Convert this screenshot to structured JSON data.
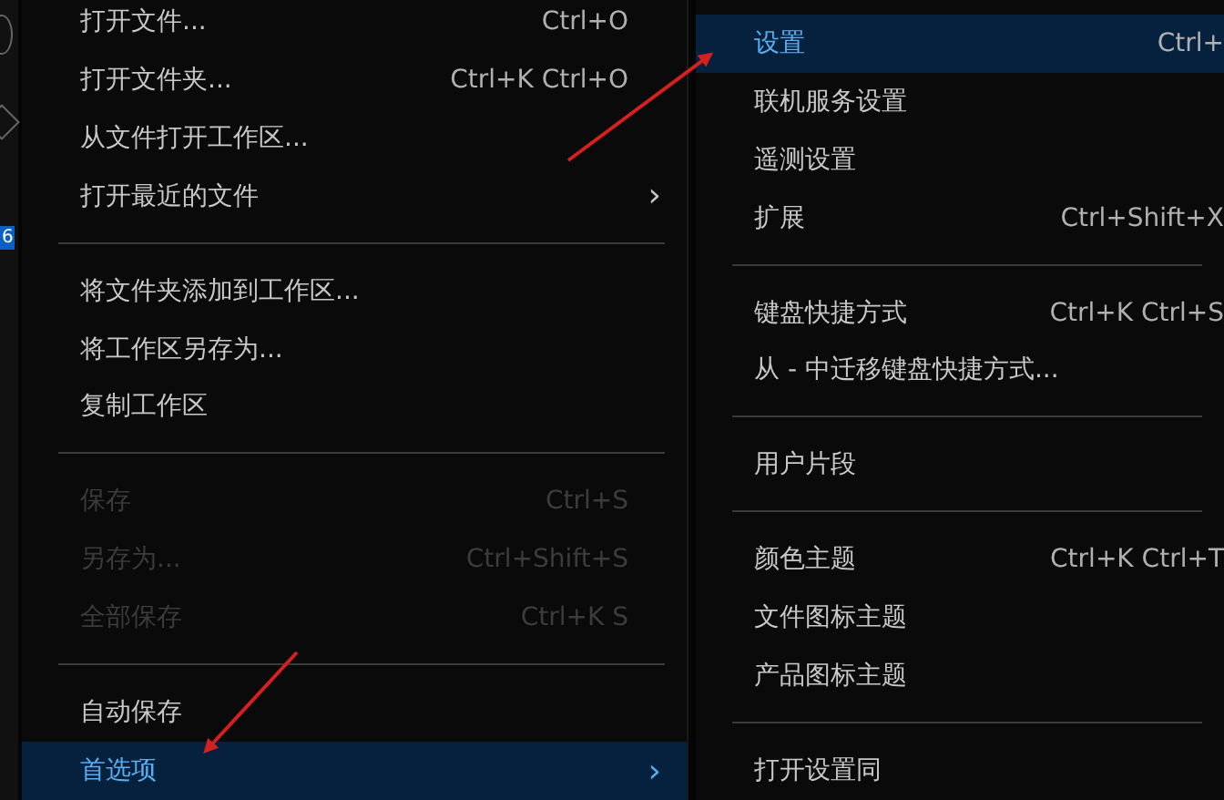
{
  "activity_bar": {
    "badge": "6"
  },
  "file_menu": [
    {
      "kind": "item",
      "label": "打开文件...",
      "shortcut": "Ctrl+O",
      "disabled": false,
      "selected": false
    },
    {
      "kind": "item",
      "label": "打开文件夹...",
      "shortcut": "Ctrl+K Ctrl+O",
      "disabled": false,
      "selected": false
    },
    {
      "kind": "item",
      "label": "从文件打开工作区...",
      "disabled": false,
      "selected": false
    },
    {
      "kind": "item",
      "label": "打开最近的文件",
      "submenu": "›",
      "disabled": false,
      "selected": false
    },
    {
      "kind": "separator"
    },
    {
      "kind": "item",
      "label": "将文件夹添加到工作区...",
      "disabled": false,
      "selected": false
    },
    {
      "kind": "item",
      "label": "将工作区另存为...",
      "disabled": false,
      "selected": false
    },
    {
      "kind": "item",
      "label": "复制工作区",
      "disabled": false,
      "selected": false
    },
    {
      "kind": "separator"
    },
    {
      "kind": "item",
      "label": "保存",
      "shortcut": "Ctrl+S",
      "disabled": true,
      "selected": false
    },
    {
      "kind": "item",
      "label": "另存为...",
      "shortcut": "Ctrl+Shift+S",
      "disabled": true,
      "selected": false
    },
    {
      "kind": "item",
      "label": "全部保存",
      "shortcut": "Ctrl+K S",
      "disabled": true,
      "selected": false
    },
    {
      "kind": "separator"
    },
    {
      "kind": "item",
      "label": "自动保存",
      "disabled": false,
      "selected": false
    },
    {
      "kind": "item",
      "label": "首选项",
      "submenu": "›",
      "disabled": false,
      "selected": true
    }
  ],
  "preferences_submenu": [
    {
      "kind": "item",
      "label": "设置",
      "shortcut": "Ctrl+",
      "disabled": false,
      "selected": true
    },
    {
      "kind": "item",
      "label": "联机服务设置",
      "disabled": false,
      "selected": false
    },
    {
      "kind": "item",
      "label": "遥测设置",
      "disabled": false,
      "selected": false
    },
    {
      "kind": "item",
      "label": "扩展",
      "shortcut": "Ctrl+Shift+X",
      "disabled": false,
      "selected": false
    },
    {
      "kind": "separator"
    },
    {
      "kind": "item",
      "label": "键盘快捷方式",
      "shortcut": "Ctrl+K Ctrl+S",
      "disabled": false,
      "selected": false
    },
    {
      "kind": "item",
      "label": "从 - 中迁移键盘快捷方式...",
      "disabled": false,
      "selected": false
    },
    {
      "kind": "separator"
    },
    {
      "kind": "item",
      "label": "用户片段",
      "disabled": false,
      "selected": false
    },
    {
      "kind": "separator"
    },
    {
      "kind": "item",
      "label": "颜色主题",
      "shortcut": "Ctrl+K Ctrl+T",
      "disabled": false,
      "selected": false
    },
    {
      "kind": "item",
      "label": "文件图标主题",
      "disabled": false,
      "selected": false
    },
    {
      "kind": "item",
      "label": "产品图标主题",
      "disabled": false,
      "selected": false
    },
    {
      "kind": "separator"
    },
    {
      "kind": "item",
      "label": "打开设置同",
      "disabled": false,
      "selected": false
    }
  ]
}
